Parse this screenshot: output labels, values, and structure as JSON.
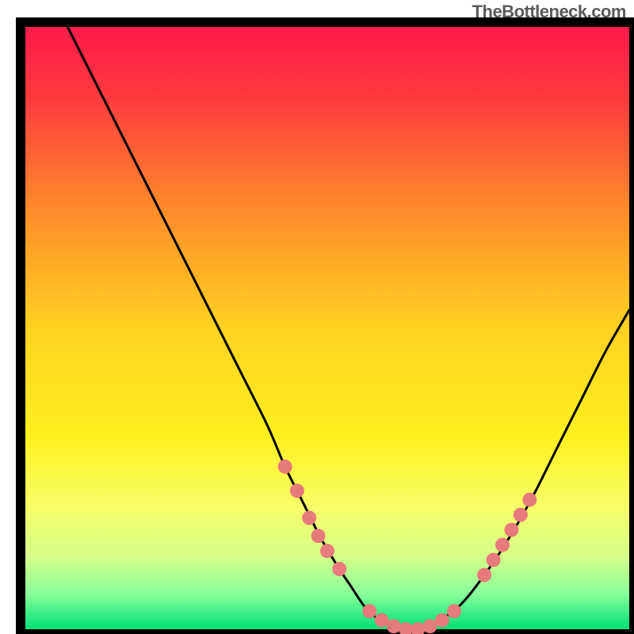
{
  "watermark": "TheBottleneck.com",
  "chart_data": {
    "type": "line",
    "title": "",
    "xlabel": "",
    "ylabel": "",
    "xlim": [
      0,
      100
    ],
    "ylim": [
      0,
      100
    ],
    "background": {
      "type": "vertical_gradient",
      "stops": [
        {
          "offset": 0.0,
          "color": "#ff1a4a"
        },
        {
          "offset": 0.12,
          "color": "#ff3b3f"
        },
        {
          "offset": 0.3,
          "color": "#ff8a2a"
        },
        {
          "offset": 0.5,
          "color": "#ffd220"
        },
        {
          "offset": 0.68,
          "color": "#fff020"
        },
        {
          "offset": 0.8,
          "color": "#f7ff6a"
        },
        {
          "offset": 0.88,
          "color": "#d5ff8a"
        },
        {
          "offset": 0.94,
          "color": "#8aff9a"
        },
        {
          "offset": 1.0,
          "color": "#00e078"
        }
      ]
    },
    "series": [
      {
        "name": "bottleneck-curve",
        "color": "#000000",
        "x": [
          7,
          10,
          15,
          20,
          25,
          30,
          35,
          40,
          43,
          46,
          49,
          52,
          54,
          56,
          58,
          60,
          62,
          64,
          66,
          68,
          72,
          76,
          80,
          84,
          88,
          92,
          96,
          100
        ],
        "y": [
          100,
          94,
          84,
          74,
          64,
          54,
          44,
          34,
          27,
          21,
          15,
          10,
          7,
          4,
          2,
          1,
          0,
          0,
          0,
          1,
          4,
          9,
          15,
          22,
          30,
          38,
          46,
          53
        ]
      }
    ],
    "markers": {
      "name": "highlight-dots",
      "color": "#e77a7a",
      "radius": 9,
      "points": [
        {
          "x": 43,
          "y": 27
        },
        {
          "x": 45,
          "y": 23
        },
        {
          "x": 47,
          "y": 18.5
        },
        {
          "x": 48.5,
          "y": 15.5
        },
        {
          "x": 50,
          "y": 13
        },
        {
          "x": 52,
          "y": 10
        },
        {
          "x": 57,
          "y": 3
        },
        {
          "x": 59,
          "y": 1.5
        },
        {
          "x": 61,
          "y": 0.5
        },
        {
          "x": 63,
          "y": 0
        },
        {
          "x": 65,
          "y": 0
        },
        {
          "x": 67,
          "y": 0.5
        },
        {
          "x": 69,
          "y": 1.5
        },
        {
          "x": 71,
          "y": 3
        },
        {
          "x": 76,
          "y": 9
        },
        {
          "x": 77.5,
          "y": 11.5
        },
        {
          "x": 79,
          "y": 14
        },
        {
          "x": 80.5,
          "y": 16.5
        },
        {
          "x": 82,
          "y": 19
        },
        {
          "x": 83.5,
          "y": 21.5
        }
      ]
    }
  }
}
